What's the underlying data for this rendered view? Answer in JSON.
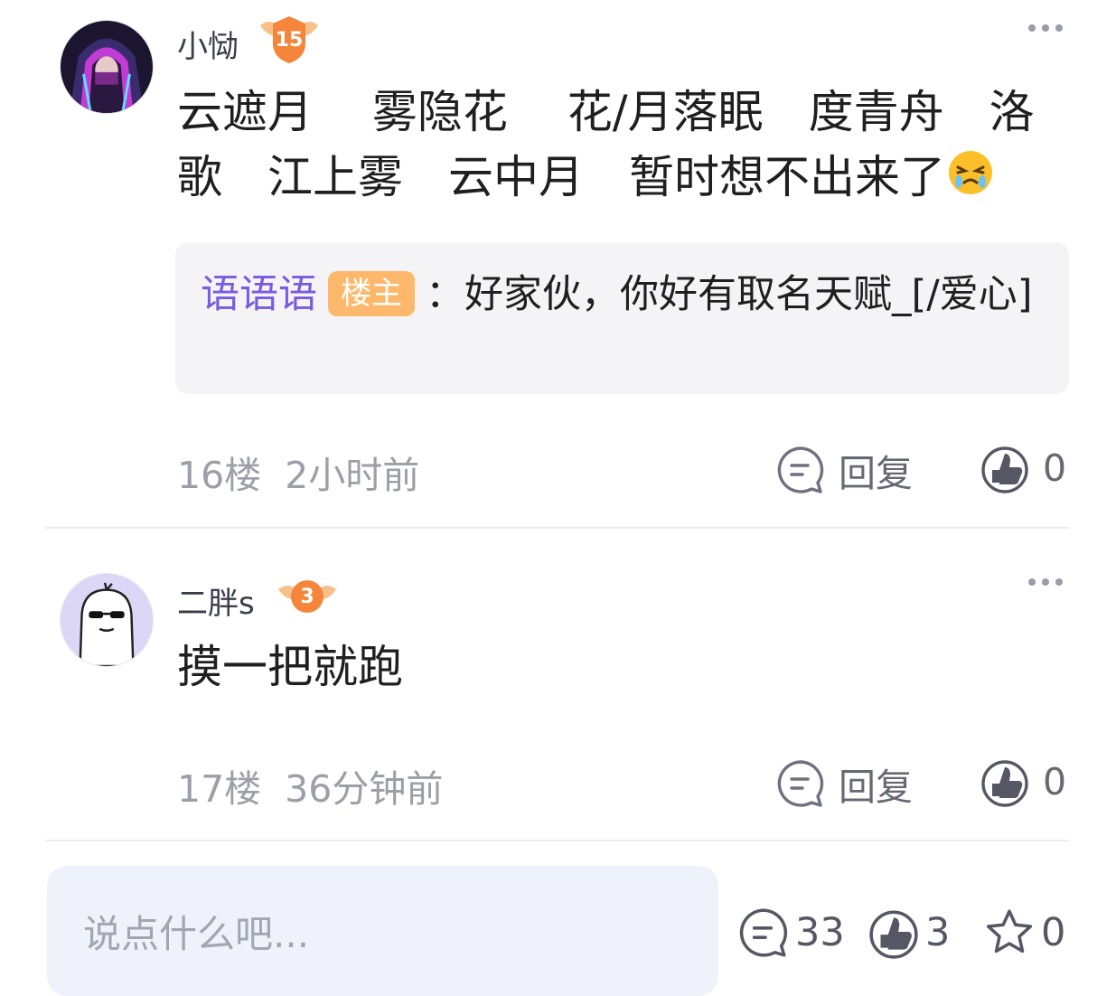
{
  "comments": [
    {
      "username": "小恸",
      "level": "15",
      "content": "云遮月　 雾隐花　 花/月落眠　度青舟　洛歌　江上雾　云中月　暂时想不出来了",
      "emoji": "crying-face-emoji",
      "reply": {
        "username": "语语语",
        "owner_tag": "楼主",
        "separator": "：",
        "text": "好家伙，你好有取名天赋_[/爱心]"
      },
      "floor": "16楼",
      "time": "2小时前",
      "reply_label": "回复",
      "like_count": "0"
    },
    {
      "username": "二胖s",
      "level": "3",
      "content": "摸一把就跑",
      "floor": "17楼",
      "time": "36分钟前",
      "reply_label": "回复",
      "like_count": "0"
    }
  ],
  "bottom_bar": {
    "input_placeholder": "说点什么吧...",
    "comment_count": "33",
    "like_count": "3",
    "favorite_count": "0"
  },
  "colors": {
    "reply_user": "#7a5ae0",
    "owner_tag_bg": "#fdb86b",
    "meta_text": "#9c9ea8",
    "input_bg": "#eff2fb",
    "divider": "#ececef"
  }
}
